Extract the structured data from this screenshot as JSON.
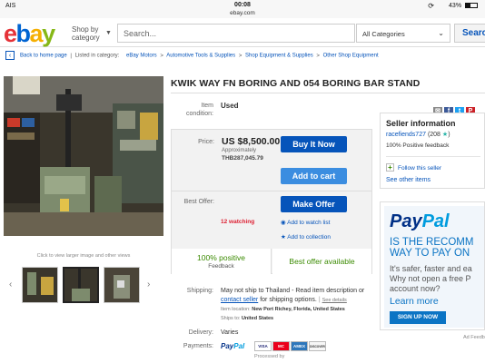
{
  "status_bar": {
    "carrier": "AIS",
    "time": "00:08",
    "host": "ebay.com",
    "battery": "43%",
    "battery_fraction": 0.43
  },
  "header": {
    "logo": {
      "e": "e",
      "b": "b",
      "a": "a",
      "y": "y"
    },
    "shop_by_category": [
      "Shop by",
      "category"
    ],
    "search_placeholder": "Search...",
    "category_select": "All Categories",
    "search_button": "Search"
  },
  "breadcrumbs": {
    "back": "Back to home page",
    "listed_in": "Listed in category:",
    "items": [
      "eBay Motors",
      "Automotive Tools & Supplies",
      "Shop Equipment & Supplies",
      "Other Shop Equipment"
    ],
    "separator": ">"
  },
  "gallery": {
    "caption": "Click to view larger image and other views",
    "thumb_count": 3,
    "selected_thumb": 1
  },
  "listing": {
    "title": "KWIK WAY FN BORING AND 054 BORING BAR STAND",
    "condition_label": [
      "Item",
      "condition:"
    ],
    "condition": "Used",
    "price_label": "Price:",
    "price": "US $8,500.00",
    "approx_label": "Approximately",
    "approx_value": "THB287,045.79",
    "buy_now": "Buy It Now",
    "add_to_cart": "Add to cart",
    "best_offer_label": "Best Offer:",
    "make_offer": "Make Offer",
    "watching": "12 watching",
    "add_watch": "Add to watch list",
    "add_collection": "Add to collection",
    "positive_pct": "100% positive",
    "feedback": "Feedback",
    "best_offer_available": "Best offer available"
  },
  "share_icons": [
    {
      "name": "email-icon",
      "color": "#888888",
      "glyph": "✉"
    },
    {
      "name": "facebook-icon",
      "color": "#3b5998",
      "glyph": "f"
    },
    {
      "name": "twitter-icon",
      "color": "#1da1f2",
      "glyph": "t"
    },
    {
      "name": "pinterest-icon",
      "color": "#cb2027",
      "glyph": "P"
    },
    {
      "name": "heart-icon",
      "color": "#dd1e31",
      "glyph": "♥"
    }
  ],
  "shipping": {
    "label": "Shipping:",
    "line1": "May not ship to Thailand - Read item description or",
    "contact": "contact seller",
    "line2": "for shipping options.",
    "see_details": "See details",
    "location_label": "Item location:",
    "location": "New Port Richey, Florida, United States",
    "ships_to_label": "Ships to:",
    "ships_to": "United States",
    "delivery_label": "Delivery:",
    "delivery": "Varies",
    "payments_label": "Payments:",
    "paypal": [
      "Pay",
      "Pal"
    ],
    "cards": [
      "VISA",
      "MC",
      "AMEX",
      "DISCOVER"
    ],
    "processed_by": "Processed by"
  },
  "seller": {
    "heading": "Seller information",
    "name": "racefiends727",
    "score": "(208",
    "score_close": ")",
    "positive": "100% Positive feedback",
    "follow": "Follow this seller",
    "other_items": "See other items"
  },
  "ad": {
    "logo": [
      "Pay",
      "Pal"
    ],
    "headline": [
      "IS THE RECOMM",
      "WAY TO PAY ON"
    ],
    "sub": [
      "It's safer, faster and ea",
      "Why not open a free P",
      "account now?"
    ],
    "learn_more": "Learn more",
    "signup": "SIGN UP NOW",
    "feedback": "Ad Feedb"
  },
  "colors": {
    "ebay_red": "#e53238",
    "ebay_blue": "#0064d2",
    "ebay_yellow": "#f5af02",
    "ebay_green": "#86b817",
    "button_blue": "#0654ba",
    "positive_green": "#3a8a00"
  }
}
